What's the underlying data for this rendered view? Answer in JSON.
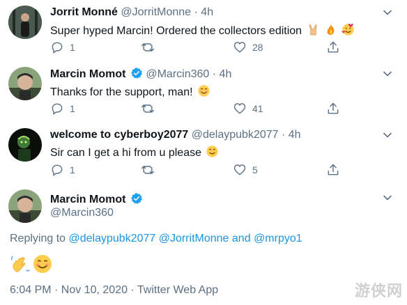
{
  "tweets": [
    {
      "name": "Jorrit Monné",
      "handle": "@JorritMonne",
      "dot": "·",
      "time": "4h",
      "text": "Super hyped Marcin! Ordered the collectors edition",
      "emoji_icons": [
        "sign-of-horns-emoji",
        "fire-emoji",
        "smiling-face-hearts-emoji"
      ],
      "replies": "1",
      "retweets": "",
      "likes": "28"
    },
    {
      "name": "Marcin Momot",
      "handle": "@Marcin360",
      "dot": "·",
      "time": "4h",
      "verified": true,
      "text": "Thanks for the support, man!",
      "emoji_icons": [
        "smiling-face-emoji"
      ],
      "replies": "1",
      "retweets": "",
      "likes": "41"
    },
    {
      "name": "welcome to cyberboy2077",
      "handle": "@delaypubk2077",
      "dot": "·",
      "time": "4h",
      "text": "Sir can I get a hi from u please",
      "emoji_icons": [
        "smiling-face-emoji"
      ],
      "replies": "1",
      "retweets": "",
      "likes": "5"
    }
  ],
  "main_tweet": {
    "name": "Marcin Momot",
    "handle": "@Marcin360",
    "verified": true,
    "replying_prefix": "Replying to",
    "mention_1": "@delaypubk2077",
    "mention_2": "@JorritMonne",
    "and_word": "and",
    "mention_3": "@mrpyo1",
    "emoji_icons": [
      "waving-hand-emoji",
      "smiling-face-emoji"
    ],
    "timestamp": "6:04 PM · Nov 10, 2020 · Twitter Web App"
  },
  "watermark": "游侠网",
  "colors": {
    "link": "#1b95e0",
    "verified": "#1da1f2",
    "muted": "#5b7083",
    "text": "#0f1419"
  }
}
